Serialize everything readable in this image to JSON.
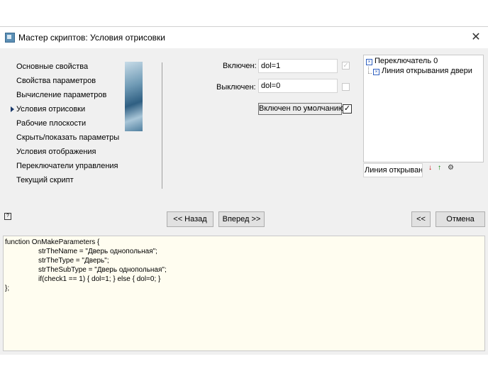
{
  "window": {
    "title": "Мастер скриптов:  Условия отрисовки",
    "close_label": "✕"
  },
  "steps": [
    {
      "label": "Основные свойства",
      "active": false
    },
    {
      "label": "Свойства параметров",
      "active": false
    },
    {
      "label": "Вычисление параметров",
      "active": false
    },
    {
      "label": "Условия отрисовки",
      "active": true
    },
    {
      "label": "Рабочие плоскости",
      "active": false
    },
    {
      "label": "Скрыть/показать параметры",
      "active": false
    },
    {
      "label": "Условия отображения",
      "active": false
    },
    {
      "label": "Переключатели управления",
      "active": false
    },
    {
      "label": "Текущий скрипт",
      "active": false
    }
  ],
  "form": {
    "enabled_label": "Включен:",
    "enabled_value": "dol=1",
    "disabled_label": "Выключен:",
    "disabled_value": "dol=0",
    "default_button": "Включен по умолчанию",
    "default_checked": "✓"
  },
  "tree": {
    "root": "Переключатель 0",
    "child": "Линия открывания двери"
  },
  "name_field": "Линия открыван",
  "tools": {
    "down_arrow": "↓",
    "up_arrow": "↑",
    "settings": "⚙"
  },
  "buttons": {
    "back": "<< Назад",
    "next": "Вперед >>",
    "collapse": "<<",
    "cancel": "Отмена"
  },
  "help_icon": "?",
  "code": {
    "lines": [
      {
        "text": "function OnMakeParameters {",
        "indent": false
      },
      {
        "text": "strTheName = \"Дверь однопольная\";",
        "indent": true
      },
      {
        "text": "strTheType = \"Дверь\";",
        "indent": true
      },
      {
        "text": "strTheSubType = \"Дверь однопольная\";",
        "indent": true
      },
      {
        "text": "if(check1 == 1) { dol=1; } else { dol=0; }",
        "indent": true
      },
      {
        "text": "};",
        "indent": false
      }
    ]
  },
  "colors": {
    "accent_arrow": "#1b3a6b",
    "code_bg": "#fffdf0",
    "down_arrow": "#c00000",
    "up_arrow": "#008000"
  }
}
